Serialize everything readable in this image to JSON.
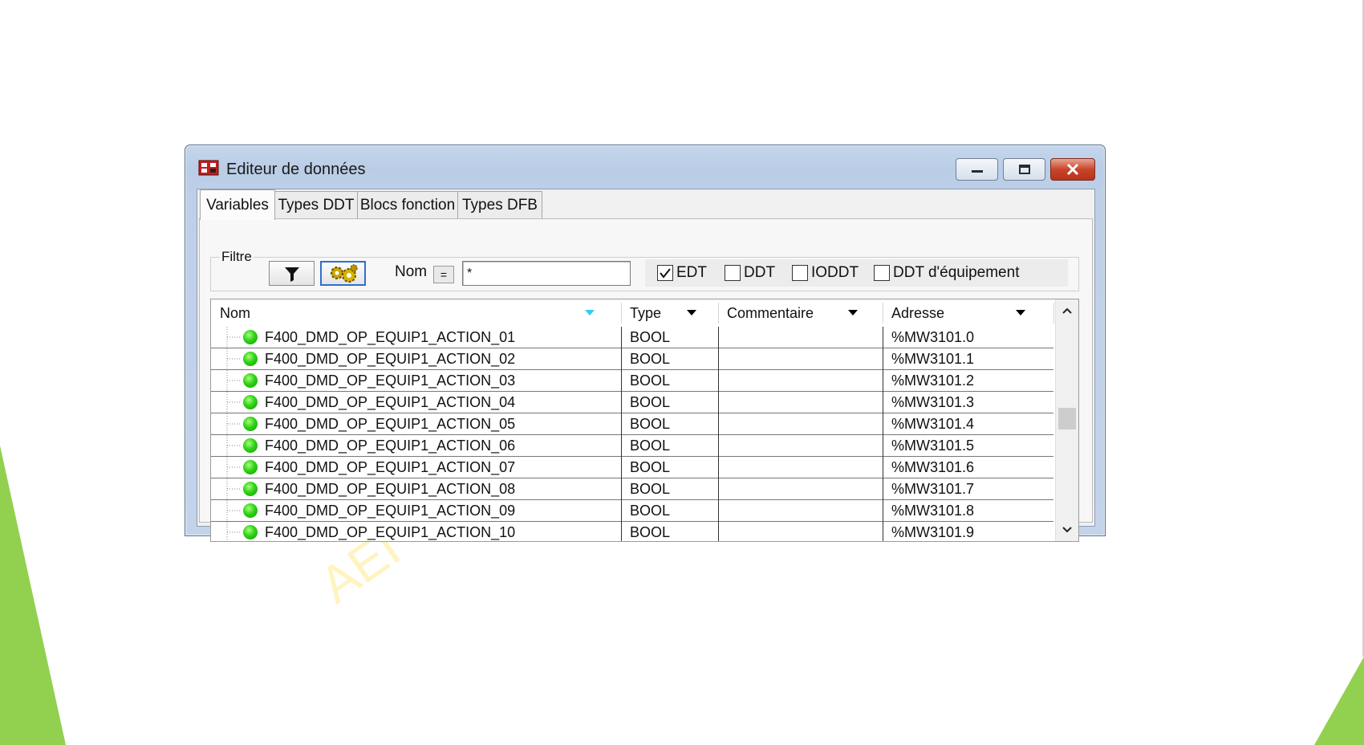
{
  "window": {
    "title": "Editeur de données"
  },
  "tabs": [
    {
      "label": "Variables",
      "active": true
    },
    {
      "label": "Types DDT",
      "active": false
    },
    {
      "label": "Blocs fonction",
      "active": false
    },
    {
      "label": "Types DFB",
      "active": false
    }
  ],
  "filter": {
    "group_label": "Filtre",
    "name_label": "Nom",
    "equal_label": "=",
    "name_value": "*",
    "checkboxes": [
      {
        "label": "EDT",
        "checked": true
      },
      {
        "label": "DDT",
        "checked": false
      },
      {
        "label": "IODDT",
        "checked": false
      },
      {
        "label": "DDT d'équipement",
        "checked": false
      }
    ]
  },
  "table": {
    "columns": [
      "Nom",
      "Type",
      "Commentaire",
      "Adresse"
    ],
    "rows": [
      {
        "name": "F400_DMD_OP_EQUIP1_ACTION_01",
        "type": "BOOL",
        "comment": "",
        "address": "%MW3101.0"
      },
      {
        "name": "F400_DMD_OP_EQUIP1_ACTION_02",
        "type": "BOOL",
        "comment": "",
        "address": "%MW3101.1"
      },
      {
        "name": "F400_DMD_OP_EQUIP1_ACTION_03",
        "type": "BOOL",
        "comment": "",
        "address": "%MW3101.2"
      },
      {
        "name": "F400_DMD_OP_EQUIP1_ACTION_04",
        "type": "BOOL",
        "comment": "",
        "address": "%MW3101.3"
      },
      {
        "name": "F400_DMD_OP_EQUIP1_ACTION_05",
        "type": "BOOL",
        "comment": "",
        "address": "%MW3101.4"
      },
      {
        "name": "F400_DMD_OP_EQUIP1_ACTION_06",
        "type": "BOOL",
        "comment": "",
        "address": "%MW3101.5"
      },
      {
        "name": "F400_DMD_OP_EQUIP1_ACTION_07",
        "type": "BOOL",
        "comment": "",
        "address": "%MW3101.6"
      },
      {
        "name": "F400_DMD_OP_EQUIP1_ACTION_08",
        "type": "BOOL",
        "comment": "",
        "address": "%MW3101.7"
      },
      {
        "name": "F400_DMD_OP_EQUIP1_ACTION_09",
        "type": "BOOL",
        "comment": "",
        "address": "%MW3101.8"
      },
      {
        "name": "F400_DMD_OP_EQUIP1_ACTION_10",
        "type": "BOOL",
        "comment": "",
        "address": "%MW3101.9"
      }
    ]
  },
  "watermark": "AEI",
  "colors": {
    "slide_accent": "#92d050",
    "status_led": "#2fd317",
    "sort_indicator": "#33ccee"
  }
}
